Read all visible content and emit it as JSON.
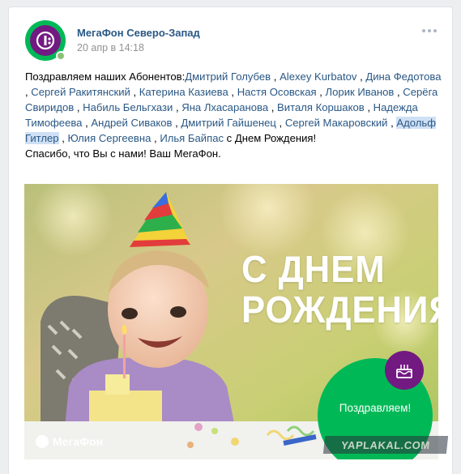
{
  "post": {
    "author": "МегаФон Северо-Запад",
    "date": "20 апр в 14:18",
    "text_intro": "Поздравляем наших Абонентов:",
    "names": [
      "Дмитрий Голубев",
      "Alexey Kurbatov",
      "Дина Федотова",
      "Сергей Ракитянский",
      "Катерина Казиева",
      "Настя Осовская",
      "Лорик Иванов",
      "Серёга Свиридов",
      "Набиль Бельгхази",
      "Яна Лхасаранова",
      "Виталя Коршаков",
      "Надежда Тимофеева",
      "Андрей Сиваков",
      "Дмитрий Гайшенец",
      "Сергей Макаровский",
      "Адольф Гитлер",
      "Юлия Сергеевна",
      "Илья Байпас"
    ],
    "text_birthday": "с Днем Рождения!",
    "text_thanks": "Спасибо, что Вы с нами! Ваш МегаФон."
  },
  "image": {
    "headline_line1": "С ДНЕМ",
    "headline_line2": "РОЖДЕНИЯ",
    "badge_text": "Поздравляем!",
    "logo_text": "МегаФон"
  },
  "watermark": "YAPLAKAL.COM",
  "colors": {
    "brand_green": "#00b956",
    "brand_purple": "#731982",
    "link": "#2a5885"
  }
}
